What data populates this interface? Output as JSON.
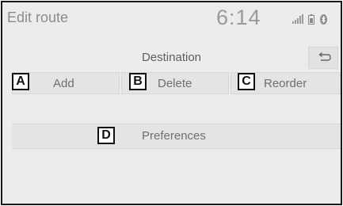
{
  "header": {
    "title": "Edit route",
    "time": "6:14",
    "icons": [
      "signal-strength-icon",
      "battery-icon",
      "bluetooth-icon"
    ]
  },
  "section": {
    "title": "Destination"
  },
  "actions": [
    {
      "callout": "A",
      "label": "Add"
    },
    {
      "callout": "B",
      "label": "Delete"
    },
    {
      "callout": "C",
      "label": "Reorder"
    }
  ],
  "preferences": {
    "callout": "D",
    "label": "Preferences"
  },
  "back": {
    "icon": "back-arrow-icon"
  }
}
